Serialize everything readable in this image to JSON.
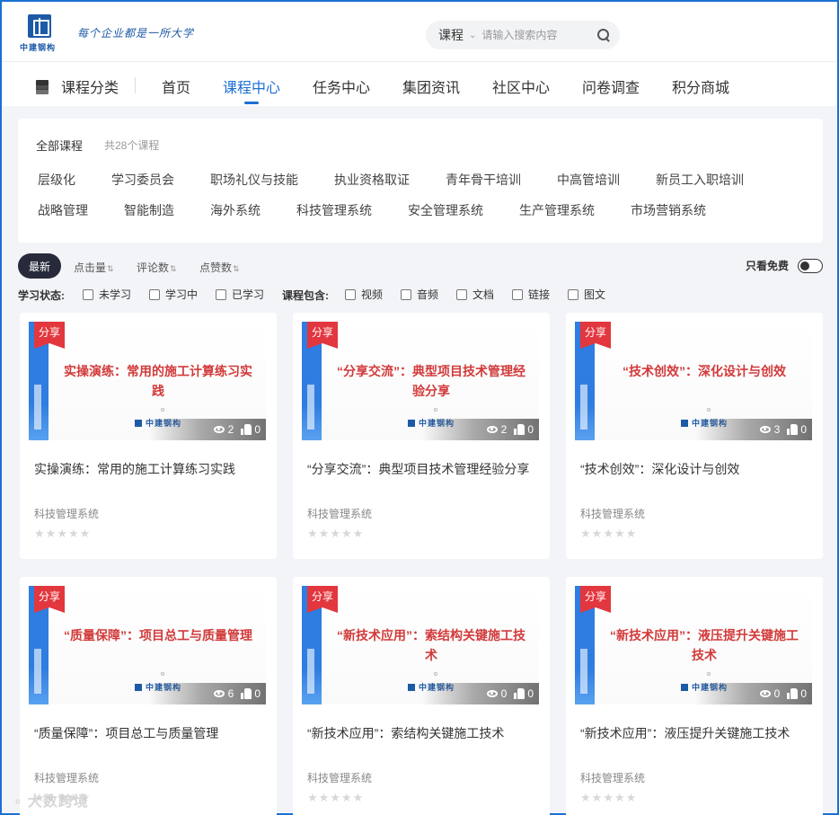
{
  "header": {
    "logo_text": "中建钢构",
    "slogan": "每个企业都是一所大学",
    "search": {
      "scope": "课程",
      "placeholder": "请输入搜索内容"
    }
  },
  "nav": {
    "category_label": "课程分类",
    "items": [
      "首页",
      "课程中心",
      "任务中心",
      "集团资讯",
      "社区中心",
      "问卷调查",
      "积分商城"
    ],
    "active": "课程中心"
  },
  "filter": {
    "all_label": "全部课程",
    "count": "共28个课程",
    "tags_row1": [
      "层级化",
      "学习委员会",
      "职场礼仪与技能",
      "执业资格取证",
      "青年骨干培训",
      "中高管培训",
      "新员工入职培训"
    ],
    "tags_row2": [
      "战略管理",
      "智能制造",
      "海外系统",
      "科技管理系统",
      "安全管理系统",
      "生产管理系统",
      "市场营销系统"
    ]
  },
  "sort": {
    "active": "最新",
    "options": [
      "点击量",
      "评论数",
      "点赞数"
    ],
    "free_only_label": "只看免费"
  },
  "status": {
    "label": "学习状态:",
    "options": [
      "未学习",
      "学习中",
      "已学习"
    ],
    "include_label": "课程包含:",
    "include_options": [
      "视频",
      "音频",
      "文档",
      "链接",
      "图文"
    ]
  },
  "badge_label": "分享",
  "courses": [
    {
      "thumb_title": "实操演练：常用的施工计算练习实践",
      "title": "实操演练：常用的施工计算练习实践",
      "category": "科技管理系统",
      "views": "2",
      "likes": "0",
      "rating": 0
    },
    {
      "thumb_title": "“分享交流”：典型项目技术管理经验分享",
      "title": "“分享交流”：典型项目技术管理经验分享",
      "category": "科技管理系统",
      "views": "2",
      "likes": "0",
      "rating": 0
    },
    {
      "thumb_title": "“技术创效”：深化设计与创效",
      "title": "“技术创效”：深化设计与创效",
      "category": "科技管理系统",
      "views": "3",
      "likes": "0",
      "rating": 0
    },
    {
      "thumb_title": "“质量保障”：项目总工与质量管理",
      "title": "“质量保障”：项目总工与质量管理",
      "category": "科技管理系统",
      "views": "6",
      "likes": "0",
      "rating": 0
    },
    {
      "thumb_title": "“新技术应用”：索结构关键施工技术",
      "title": "“新技术应用”：索结构关键施工技术",
      "category": "科技管理系统",
      "views": "0",
      "likes": "0",
      "rating": 0
    },
    {
      "thumb_title": "“新技术应用”：液压提升关键施工技术",
      "title": "“新技术应用”：液压提升关键施工技术",
      "category": "科技管理系统",
      "views": "0",
      "likes": "0",
      "rating": 0
    }
  ],
  "watermark": "大数跨境",
  "colors": {
    "accent": "#1d6fd1",
    "badge": "#e2373e",
    "thumb_title": "#d23a3a",
    "brand": "#1d5aa6"
  }
}
